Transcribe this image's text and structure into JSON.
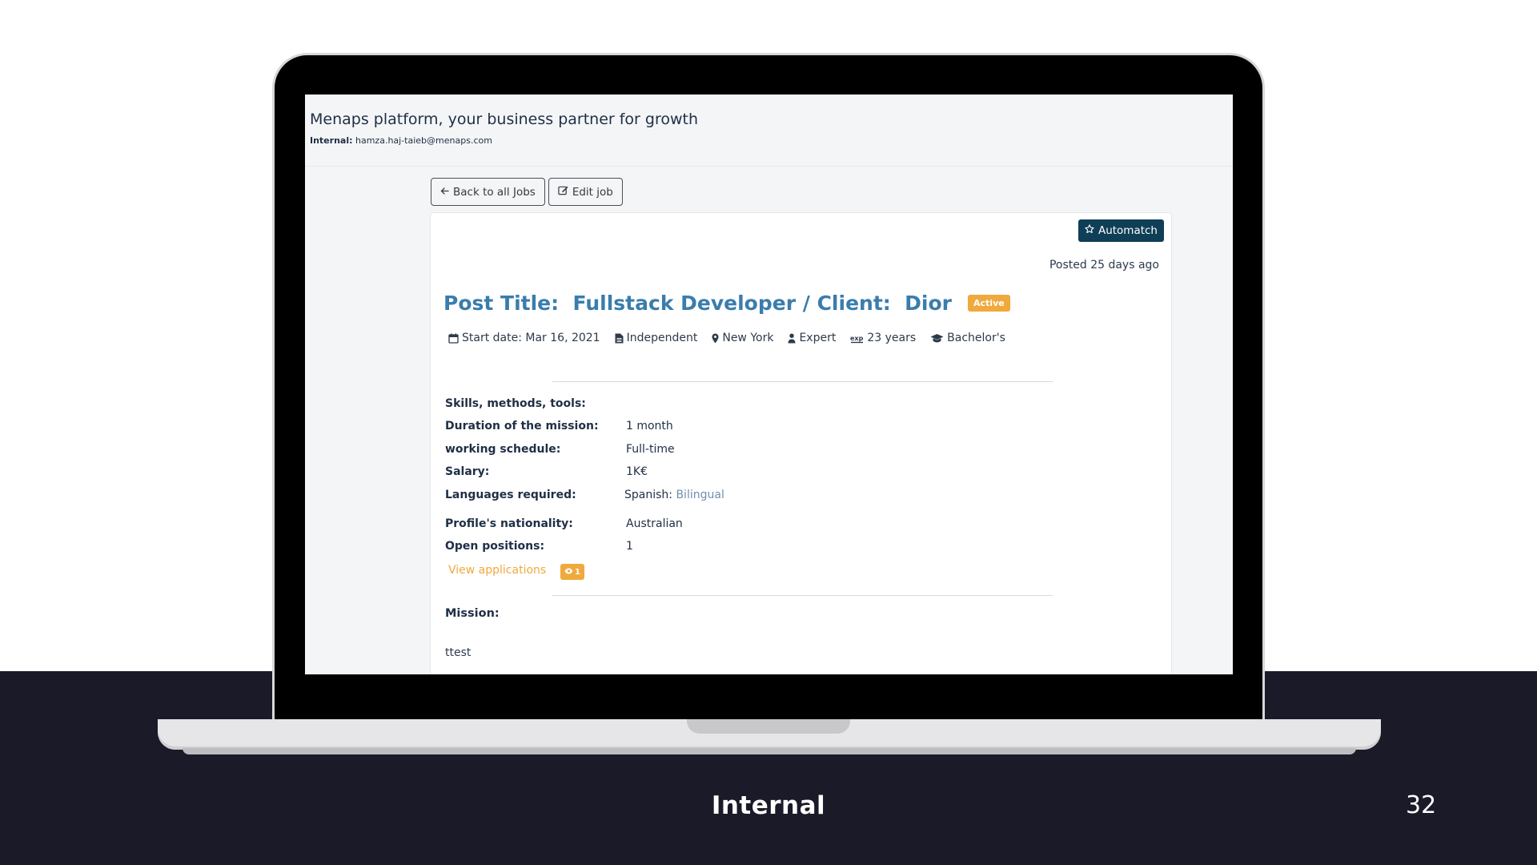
{
  "slide": {
    "footer_label": "Internal",
    "page_number": "32"
  },
  "app": {
    "title": "Menaps platform, your business partner for growth",
    "internal_label": "Internal:",
    "internal_email": "hamza.haj-taieb@menaps.com"
  },
  "toolbar": {
    "back_label": "Back to all Jobs",
    "edit_label": "Edit job"
  },
  "job": {
    "automatch_label": "Automatch",
    "posted": "Posted 25 days ago",
    "title": "Post Title:  Fullstack Developer / Client:  Dior",
    "status": "Active",
    "meta": {
      "start_date": "Start date: Mar 16, 2021",
      "contract": "Independent",
      "location": "New York",
      "level": "Expert",
      "experience": "23 years",
      "education": "Bachelor's"
    },
    "details": [
      {
        "label": "Skills, methods, tools:",
        "value": ""
      },
      {
        "label": "Duration of the mission:",
        "value": "1 month"
      },
      {
        "label": "working schedule:",
        "value": "Full-time"
      },
      {
        "label": "Salary:",
        "value": "1K€"
      },
      {
        "label": "Languages required:",
        "value": "Spanish:",
        "value_extra": "Bilingual"
      },
      {
        "label": "Profile's nationality:",
        "value": "Australian"
      },
      {
        "label": "Open positions:",
        "value": "1"
      }
    ],
    "view_applications_label": "View applications",
    "applications_count": "1",
    "mission_label": "Mission:",
    "mission_text": "ttest"
  },
  "colors": {
    "accent_title": "#3a7dac",
    "automatch_bg": "#0f3e57",
    "badge_orange": "#f0a93c",
    "band_dark": "#1b1a28"
  }
}
